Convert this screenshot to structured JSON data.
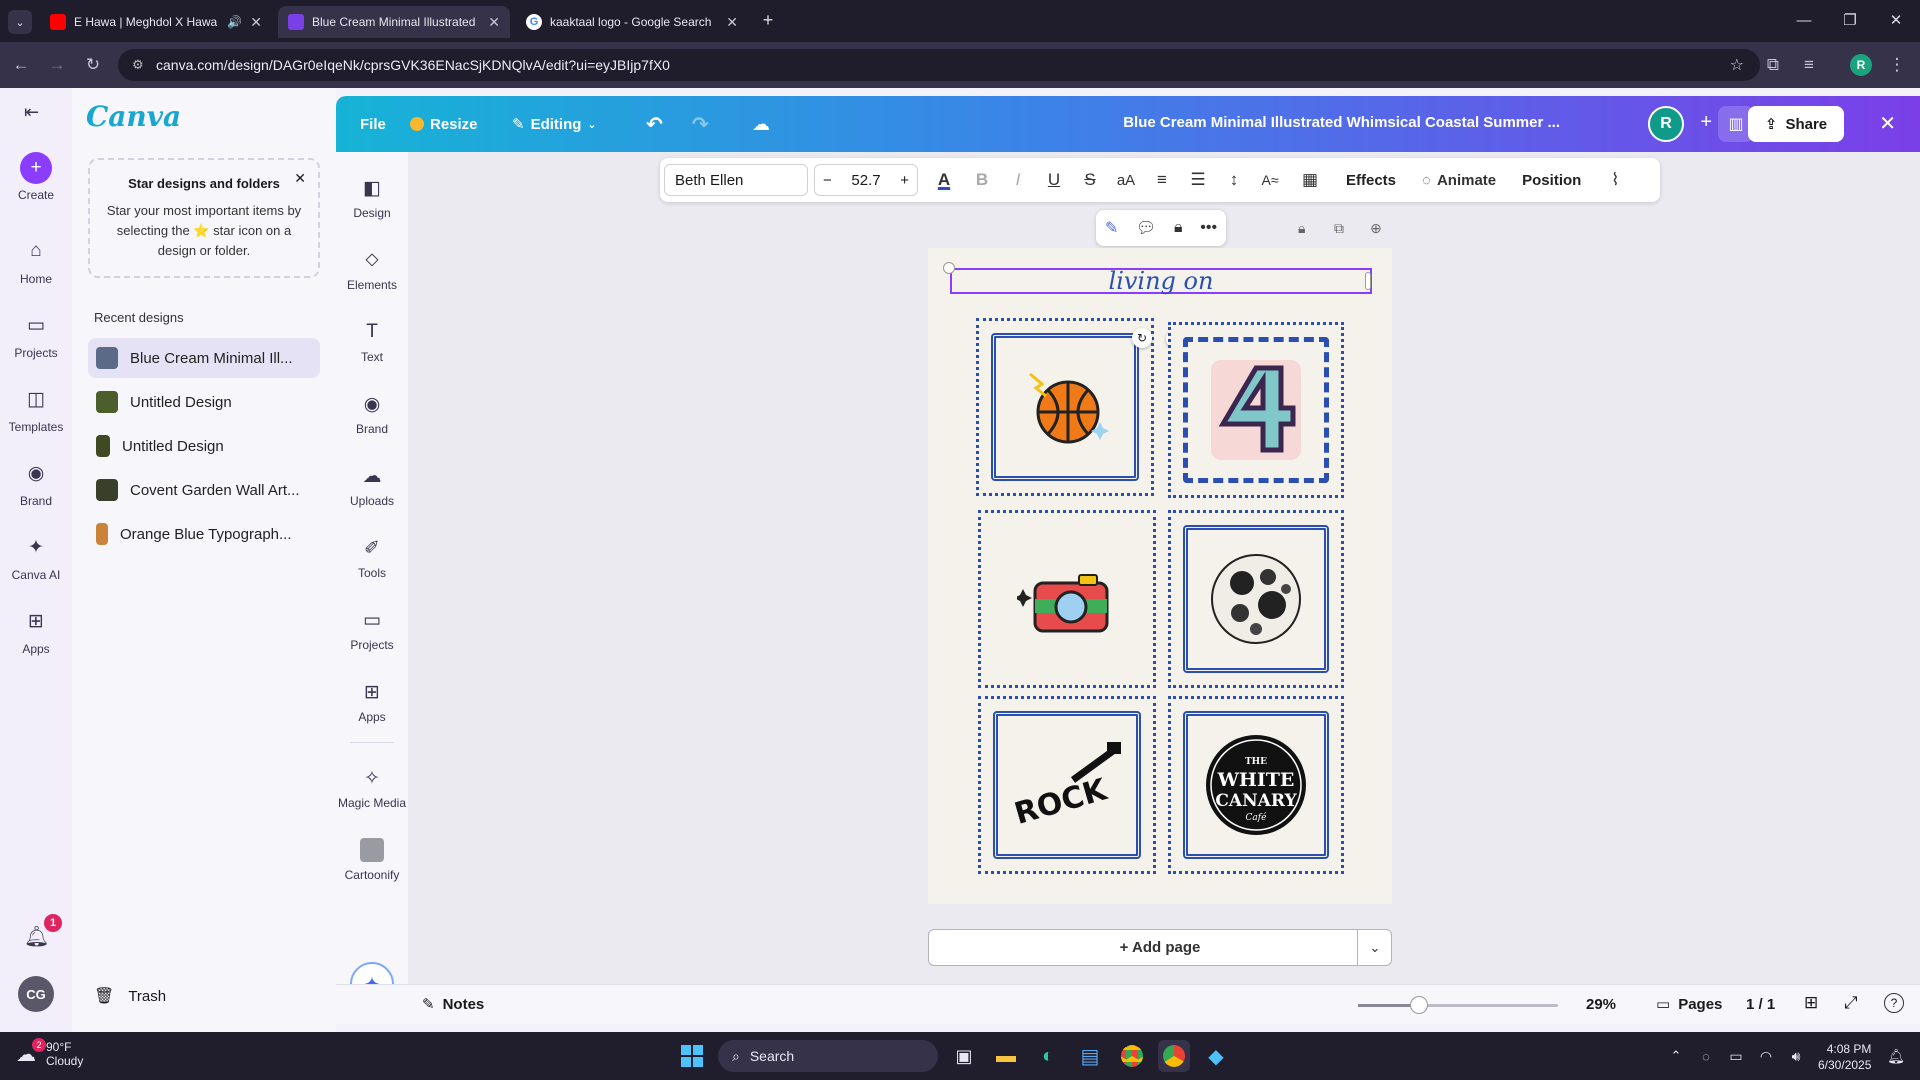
{
  "browser": {
    "tabs": [
      {
        "label": "E Hawa | Meghdol X Hawa",
        "icon": "youtube-icon",
        "color": "#ff0000",
        "audio": true
      },
      {
        "label": "Blue Cream Minimal Illustrated",
        "icon": "canva-icon",
        "color": "#7b3fe8",
        "active": true
      },
      {
        "label": "kaaktaal logo - Google Search",
        "icon": "google-icon",
        "color": "#4285f4"
      }
    ],
    "url": "canva.com/design/DAGr0eIqeNk/cprsGVK36ENacSjKDNQlvA/edit?ui=eyJBIjp7fX0",
    "profile_initial": "R"
  },
  "rail": {
    "logo": "Canva",
    "items": [
      {
        "label": "Create",
        "icon": "plus-icon"
      },
      {
        "label": "Home",
        "icon": "home-icon"
      },
      {
        "label": "Projects",
        "icon": "folder-icon"
      },
      {
        "label": "Templates",
        "icon": "templates-icon"
      },
      {
        "label": "Brand",
        "icon": "brand-icon"
      },
      {
        "label": "Canva AI",
        "icon": "sparkle-icon"
      },
      {
        "label": "Apps",
        "icon": "apps-icon"
      }
    ],
    "notif_count": "1",
    "avatar": "CG"
  },
  "panel": {
    "star_title": "Star designs and folders",
    "star_body": "Star your most important items by selecting the ⭐ star icon on a design or folder.",
    "recent_heading": "Recent designs",
    "recent": [
      {
        "label": "Blue Cream Minimal Ill...",
        "color": "#5b6a86"
      },
      {
        "label": "Untitled Design",
        "color": "#4b5e2c"
      },
      {
        "label": "Untitled Design",
        "color": "#3f4a22"
      },
      {
        "label": "Covent Garden Wall Art...",
        "color": "#3a3f2a"
      },
      {
        "label": "Orange Blue Typograph...",
        "color": "#c9833b"
      }
    ],
    "trash": "Trash"
  },
  "topbar": {
    "file": "File",
    "resize": "Resize",
    "editing": "Editing",
    "title": "Blue Cream Minimal Illustrated Whimsical Coastal Summer ...",
    "avatar": "R",
    "share": "Share"
  },
  "objects": [
    {
      "label": "Design",
      "icon": "design-icon"
    },
    {
      "label": "Elements",
      "icon": "elements-icon"
    },
    {
      "label": "Text",
      "icon": "text-icon"
    },
    {
      "label": "Brand",
      "icon": "brand-icon"
    },
    {
      "label": "Uploads",
      "icon": "upload-icon"
    },
    {
      "label": "Tools",
      "icon": "tools-icon"
    },
    {
      "label": "Projects",
      "icon": "folder-icon"
    },
    {
      "label": "Apps",
      "icon": "apps-icon"
    },
    {
      "label": "Magic Media",
      "icon": "magic-media-icon"
    },
    {
      "label": "Cartoonify",
      "icon": "cartoonify-icon"
    }
  ],
  "texttoolbar": {
    "font": "Beth Ellen",
    "size": "52.7",
    "effects": "Effects",
    "animate": "Animate",
    "position": "Position"
  },
  "page": {
    "heading": "living on",
    "frame_labels": {
      "rock": "ROCK",
      "canary_the": "THE",
      "canary_white": "WHITE",
      "canary_canary": "CANARY",
      "canary_cafe": "Café"
    }
  },
  "add_page": "+ Add page",
  "bottom": {
    "notes": "Notes",
    "zoom": "29%",
    "pages": "Pages",
    "page_count": "1 / 1"
  },
  "taskbar": {
    "temp": "90°F",
    "weather": "Cloudy",
    "weather_badge": "2",
    "search": "Search",
    "time": "4:08 PM",
    "date": "6/30/2025"
  }
}
